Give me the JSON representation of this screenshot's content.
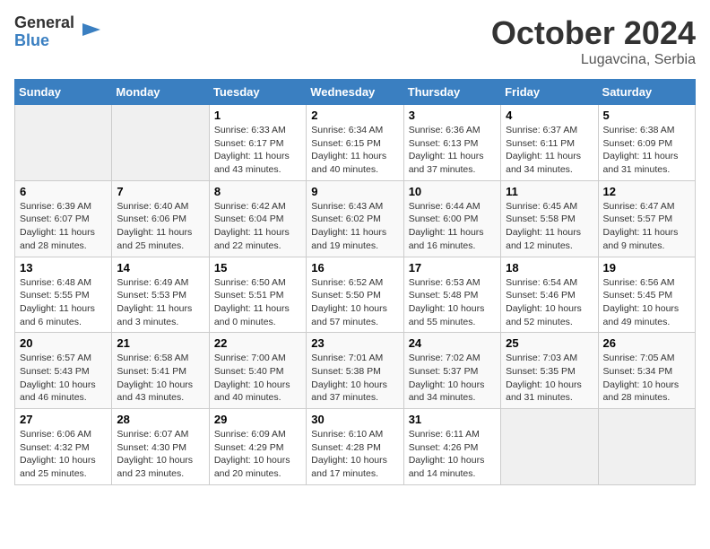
{
  "logo": {
    "general": "General",
    "blue": "Blue"
  },
  "header": {
    "month": "October 2024",
    "location": "Lugavcina, Serbia"
  },
  "weekdays": [
    "Sunday",
    "Monday",
    "Tuesday",
    "Wednesday",
    "Thursday",
    "Friday",
    "Saturday"
  ],
  "weeks": [
    [
      {
        "day": "",
        "sunrise": "",
        "sunset": "",
        "daylight": ""
      },
      {
        "day": "",
        "sunrise": "",
        "sunset": "",
        "daylight": ""
      },
      {
        "day": "1",
        "sunrise": "Sunrise: 6:33 AM",
        "sunset": "Sunset: 6:17 PM",
        "daylight": "Daylight: 11 hours and 43 minutes."
      },
      {
        "day": "2",
        "sunrise": "Sunrise: 6:34 AM",
        "sunset": "Sunset: 6:15 PM",
        "daylight": "Daylight: 11 hours and 40 minutes."
      },
      {
        "day": "3",
        "sunrise": "Sunrise: 6:36 AM",
        "sunset": "Sunset: 6:13 PM",
        "daylight": "Daylight: 11 hours and 37 minutes."
      },
      {
        "day": "4",
        "sunrise": "Sunrise: 6:37 AM",
        "sunset": "Sunset: 6:11 PM",
        "daylight": "Daylight: 11 hours and 34 minutes."
      },
      {
        "day": "5",
        "sunrise": "Sunrise: 6:38 AM",
        "sunset": "Sunset: 6:09 PM",
        "daylight": "Daylight: 11 hours and 31 minutes."
      }
    ],
    [
      {
        "day": "6",
        "sunrise": "Sunrise: 6:39 AM",
        "sunset": "Sunset: 6:07 PM",
        "daylight": "Daylight: 11 hours and 28 minutes."
      },
      {
        "day": "7",
        "sunrise": "Sunrise: 6:40 AM",
        "sunset": "Sunset: 6:06 PM",
        "daylight": "Daylight: 11 hours and 25 minutes."
      },
      {
        "day": "8",
        "sunrise": "Sunrise: 6:42 AM",
        "sunset": "Sunset: 6:04 PM",
        "daylight": "Daylight: 11 hours and 22 minutes."
      },
      {
        "day": "9",
        "sunrise": "Sunrise: 6:43 AM",
        "sunset": "Sunset: 6:02 PM",
        "daylight": "Daylight: 11 hours and 19 minutes."
      },
      {
        "day": "10",
        "sunrise": "Sunrise: 6:44 AM",
        "sunset": "Sunset: 6:00 PM",
        "daylight": "Daylight: 11 hours and 16 minutes."
      },
      {
        "day": "11",
        "sunrise": "Sunrise: 6:45 AM",
        "sunset": "Sunset: 5:58 PM",
        "daylight": "Daylight: 11 hours and 12 minutes."
      },
      {
        "day": "12",
        "sunrise": "Sunrise: 6:47 AM",
        "sunset": "Sunset: 5:57 PM",
        "daylight": "Daylight: 11 hours and 9 minutes."
      }
    ],
    [
      {
        "day": "13",
        "sunrise": "Sunrise: 6:48 AM",
        "sunset": "Sunset: 5:55 PM",
        "daylight": "Daylight: 11 hours and 6 minutes."
      },
      {
        "day": "14",
        "sunrise": "Sunrise: 6:49 AM",
        "sunset": "Sunset: 5:53 PM",
        "daylight": "Daylight: 11 hours and 3 minutes."
      },
      {
        "day": "15",
        "sunrise": "Sunrise: 6:50 AM",
        "sunset": "Sunset: 5:51 PM",
        "daylight": "Daylight: 11 hours and 0 minutes."
      },
      {
        "day": "16",
        "sunrise": "Sunrise: 6:52 AM",
        "sunset": "Sunset: 5:50 PM",
        "daylight": "Daylight: 10 hours and 57 minutes."
      },
      {
        "day": "17",
        "sunrise": "Sunrise: 6:53 AM",
        "sunset": "Sunset: 5:48 PM",
        "daylight": "Daylight: 10 hours and 55 minutes."
      },
      {
        "day": "18",
        "sunrise": "Sunrise: 6:54 AM",
        "sunset": "Sunset: 5:46 PM",
        "daylight": "Daylight: 10 hours and 52 minutes."
      },
      {
        "day": "19",
        "sunrise": "Sunrise: 6:56 AM",
        "sunset": "Sunset: 5:45 PM",
        "daylight": "Daylight: 10 hours and 49 minutes."
      }
    ],
    [
      {
        "day": "20",
        "sunrise": "Sunrise: 6:57 AM",
        "sunset": "Sunset: 5:43 PM",
        "daylight": "Daylight: 10 hours and 46 minutes."
      },
      {
        "day": "21",
        "sunrise": "Sunrise: 6:58 AM",
        "sunset": "Sunset: 5:41 PM",
        "daylight": "Daylight: 10 hours and 43 minutes."
      },
      {
        "day": "22",
        "sunrise": "Sunrise: 7:00 AM",
        "sunset": "Sunset: 5:40 PM",
        "daylight": "Daylight: 10 hours and 40 minutes."
      },
      {
        "day": "23",
        "sunrise": "Sunrise: 7:01 AM",
        "sunset": "Sunset: 5:38 PM",
        "daylight": "Daylight: 10 hours and 37 minutes."
      },
      {
        "day": "24",
        "sunrise": "Sunrise: 7:02 AM",
        "sunset": "Sunset: 5:37 PM",
        "daylight": "Daylight: 10 hours and 34 minutes."
      },
      {
        "day": "25",
        "sunrise": "Sunrise: 7:03 AM",
        "sunset": "Sunset: 5:35 PM",
        "daylight": "Daylight: 10 hours and 31 minutes."
      },
      {
        "day": "26",
        "sunrise": "Sunrise: 7:05 AM",
        "sunset": "Sunset: 5:34 PM",
        "daylight": "Daylight: 10 hours and 28 minutes."
      }
    ],
    [
      {
        "day": "27",
        "sunrise": "Sunrise: 6:06 AM",
        "sunset": "Sunset: 4:32 PM",
        "daylight": "Daylight: 10 hours and 25 minutes."
      },
      {
        "day": "28",
        "sunrise": "Sunrise: 6:07 AM",
        "sunset": "Sunset: 4:30 PM",
        "daylight": "Daylight: 10 hours and 23 minutes."
      },
      {
        "day": "29",
        "sunrise": "Sunrise: 6:09 AM",
        "sunset": "Sunset: 4:29 PM",
        "daylight": "Daylight: 10 hours and 20 minutes."
      },
      {
        "day": "30",
        "sunrise": "Sunrise: 6:10 AM",
        "sunset": "Sunset: 4:28 PM",
        "daylight": "Daylight: 10 hours and 17 minutes."
      },
      {
        "day": "31",
        "sunrise": "Sunrise: 6:11 AM",
        "sunset": "Sunset: 4:26 PM",
        "daylight": "Daylight: 10 hours and 14 minutes."
      },
      {
        "day": "",
        "sunrise": "",
        "sunset": "",
        "daylight": ""
      },
      {
        "day": "",
        "sunrise": "",
        "sunset": "",
        "daylight": ""
      }
    ]
  ]
}
